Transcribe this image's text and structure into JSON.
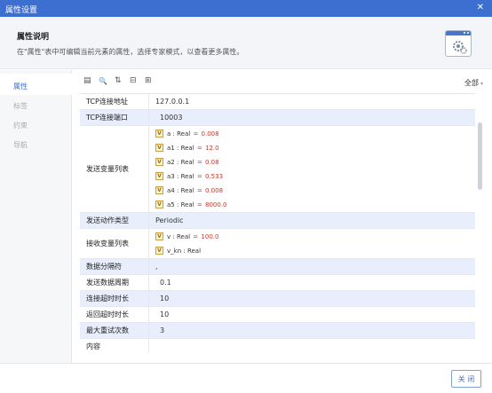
{
  "window": {
    "title": "属性设置",
    "close_glyph": "✕"
  },
  "info": {
    "heading": "属性说明",
    "desc": "在\"属性\"表中可编辑当前元素的属性，选择专家模式，以查看更多属性。",
    "icon": "settings-gear-icon"
  },
  "sidebar": {
    "items": [
      {
        "label": "属性",
        "active": true
      },
      {
        "label": "标签",
        "active": false
      },
      {
        "label": "约束",
        "active": false
      },
      {
        "label": "导航",
        "active": false
      }
    ]
  },
  "toolbar": {
    "icons": [
      "expand-icon",
      "search-icon",
      "sort-icon",
      "collapse-all-icon",
      "expand-all-icon"
    ],
    "glyphs": [
      "▤",
      "🔍",
      "⇅",
      "⊟",
      "⊞"
    ],
    "filter_label": "全部",
    "filter_caret": "▾"
  },
  "properties": [
    {
      "label": "TCP连接地址",
      "value": "127.0.0.1"
    },
    {
      "label": "TCP连接端口",
      "value": "10003"
    },
    {
      "label": "发送变量列表",
      "items": [
        {
          "badge": "V",
          "name": "a",
          "type": "Real",
          "eq": "=",
          "num": "0.008"
        },
        {
          "badge": "V",
          "name": "a1",
          "type": "Real",
          "eq": "=",
          "num": "12.0"
        },
        {
          "badge": "V",
          "name": "a2",
          "type": "Real",
          "eq": "=",
          "num": "0.08"
        },
        {
          "badge": "V",
          "name": "a3",
          "type": "Real",
          "eq": "=",
          "num": "0.533"
        },
        {
          "badge": "V",
          "name": "a4",
          "type": "Real",
          "eq": "=",
          "num": "0.008"
        },
        {
          "badge": "V",
          "name": "a5",
          "type": "Real",
          "eq": "=",
          "num": "8000.0"
        }
      ]
    },
    {
      "label": "发送动作类型",
      "value": "Periodic"
    },
    {
      "label": "接收变量列表",
      "items": [
        {
          "badge": "V",
          "name": "v",
          "type": "Real",
          "eq": "=",
          "num": "100.0"
        },
        {
          "badge": "V",
          "name": "v_kn",
          "type": "Real",
          "eq": "",
          "num": ""
        }
      ]
    },
    {
      "label": "数据分隔符",
      "value": ","
    },
    {
      "label": "发送数据周期",
      "value": "0.1"
    },
    {
      "label": "连接超时时长",
      "value": "10"
    },
    {
      "label": "返回超时时长",
      "value": "10"
    },
    {
      "label": "最大重试次数",
      "value": "3"
    },
    {
      "label": "内容",
      "value": ""
    }
  ],
  "footer": {
    "close_label": "关 闭"
  }
}
